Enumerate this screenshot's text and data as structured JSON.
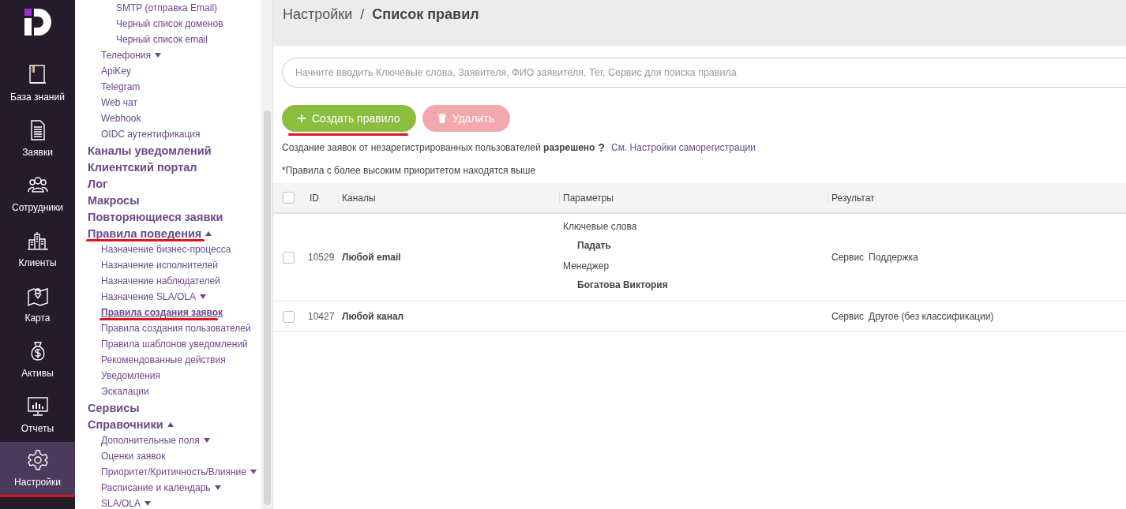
{
  "rail": {
    "items": [
      {
        "label": "База знаний",
        "selected": false
      },
      {
        "label": "Заявки",
        "selected": false
      },
      {
        "label": "Сотрудники",
        "selected": false
      },
      {
        "label": "Клиенты",
        "selected": false
      },
      {
        "label": "Карта",
        "selected": false
      },
      {
        "label": "Активы",
        "selected": false
      },
      {
        "label": "Отчеты",
        "selected": false
      },
      {
        "label": "Настройки",
        "selected": true
      }
    ]
  },
  "sidebar": {
    "items": [
      {
        "children": [
          {
            "children": [
              {
                "label": "SMTP (отправка Email)"
              },
              {
                "label": "Черный список доменов"
              },
              {
                "label": "Черный список email"
              }
            ]
          },
          {
            "label": "Телефония",
            "expanded": false
          },
          {
            "label": "ApiKey"
          },
          {
            "label": "Telegram"
          },
          {
            "label": "Web чат"
          },
          {
            "label": "Webhook"
          },
          {
            "label": "OIDC аутентификация"
          }
        ]
      },
      {
        "label": "Каналы уведомлений"
      },
      {
        "label": "Клиентский портал"
      },
      {
        "label": "Лог"
      },
      {
        "label": "Макросы"
      },
      {
        "label": "Повторяющиеся заявки"
      },
      {
        "label": "Правила поведения",
        "expanded": true,
        "annotated": true,
        "children": [
          {
            "label": "Назначение бизнес-процесса"
          },
          {
            "label": "Назначение исполнителей"
          },
          {
            "label": "Назначение наблюдателей"
          },
          {
            "label": "Назначение SLA/OLA",
            "expanded": false
          },
          {
            "label": "Правила создания заявок",
            "selected": true,
            "annotated": true
          },
          {
            "label": "Правила создания пользователей"
          },
          {
            "label": "Правила шаблонов уведомлений"
          },
          {
            "label": "Рекомендованные действия"
          },
          {
            "label": "Уведомления"
          },
          {
            "label": "Эскалации"
          }
        ]
      },
      {
        "label": "Сервисы"
      },
      {
        "label": "Справочники",
        "expanded": true,
        "children": [
          {
            "label": "Дополнительные поля",
            "expanded": false
          },
          {
            "label": "Оценки заявок"
          },
          {
            "label": "Приоритет/Критичность/Влияние",
            "expanded": false
          },
          {
            "label": "Расписание и календарь",
            "expanded": false
          },
          {
            "label": "SLA/OLA",
            "expanded": false
          }
        ]
      }
    ]
  },
  "breadcrumb": {
    "parent": "Настройки",
    "separator": "/",
    "current": "Список правил"
  },
  "search": {
    "placeholder": "Начните вводить Ключевые слова, Заявителя, ФИО заявителя, Тег, Сервис для поиска правила"
  },
  "buttons": [
    {
      "label": "Создать правило",
      "kind": "primary",
      "disabled": false,
      "annotated": true
    },
    {
      "label": "Удалить",
      "kind": "danger",
      "disabled": true,
      "annotated": false
    }
  ],
  "notice": {
    "text": "Создание заявок от незарегистрированных пользователей **разрешено**",
    "help": "?",
    "link": "См. Настройки саморегистрации"
  },
  "hint": "*Правила с более высоким приоритетом находятся выше",
  "table": {
    "all_checked": false,
    "columns": [
      "ID",
      "Каналы",
      "Параметры",
      "Результат"
    ],
    "rows": [
      {
        "checked": false,
        "id": "10529",
        "channel": "Любой email",
        "params": [
          {
            "label": "Ключевые слова",
            "value": "Падать"
          },
          {
            "label": "Менеджер",
            "value": "Богатова Виктория"
          }
        ],
        "result": {
          "label": "Сервис",
          "value": "Поддержка"
        }
      },
      {
        "checked": false,
        "id": "10427",
        "channel": "Любой канал",
        "params": [],
        "result": {
          "label": "Сервис",
          "value": "Другое (без классификации)"
        }
      }
    ]
  }
}
